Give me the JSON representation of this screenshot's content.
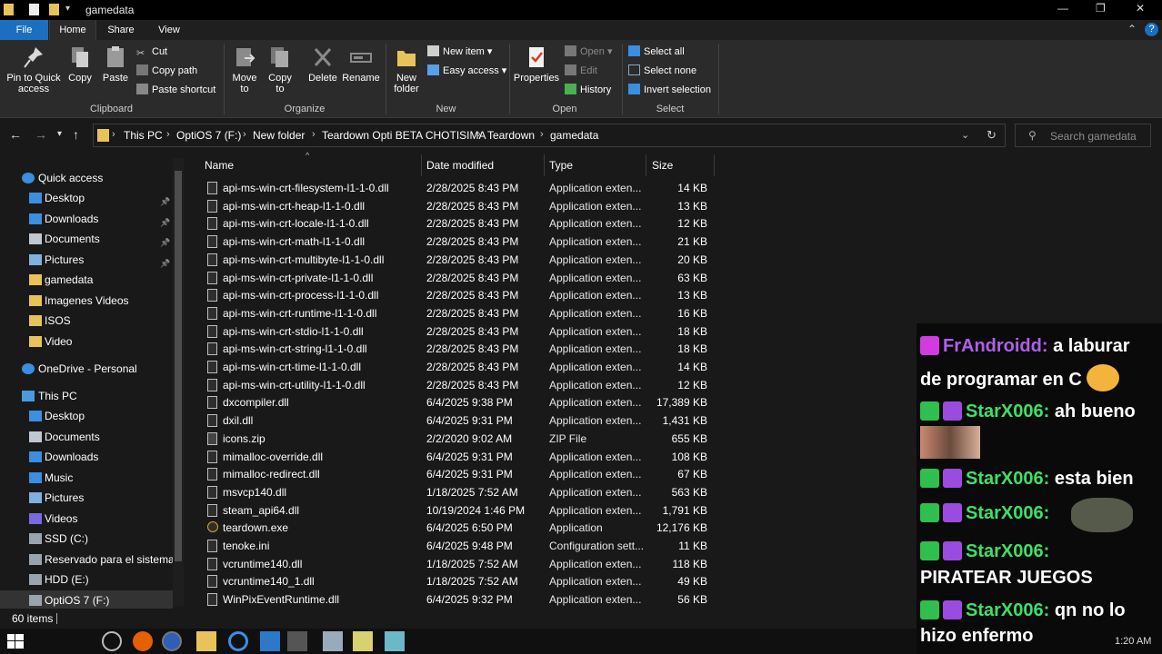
{
  "window": {
    "title": "gamedata",
    "help_glyph": "?",
    "collapse_glyph": "⌃"
  },
  "tabs": [
    "File",
    "Home",
    "Share",
    "View"
  ],
  "ribbon": {
    "clipboard": {
      "pin": "Pin to Quick access",
      "copy": "Copy",
      "paste": "Paste",
      "cut": "Cut",
      "copy_path": "Copy path",
      "paste_shortcut": "Paste shortcut",
      "label": "Clipboard"
    },
    "organize": {
      "move_to": "Move to",
      "copy_to": "Copy to",
      "delete": "Delete",
      "rename": "Rename",
      "label": "Organize"
    },
    "new": {
      "new_folder": "New folder",
      "new_item": "New item",
      "easy_access": "Easy access",
      "label": "New"
    },
    "open": {
      "properties": "Properties",
      "open": "Open",
      "edit": "Edit",
      "history": "History",
      "label": "Open"
    },
    "select": {
      "select_all": "Select all",
      "select_none": "Select none",
      "invert": "Invert selection",
      "label": "Select"
    }
  },
  "breadcrumb": [
    "This PC",
    "OptiOS 7 (F:)",
    "New folder",
    "Teardown Opti BETA CHOTISIMA",
    "Teardown",
    "gamedata"
  ],
  "search": {
    "placeholder": "Search gamedata"
  },
  "nav": [
    {
      "label": "Quick access",
      "icon": "star-icon",
      "pinned": false
    },
    {
      "label": "Desktop",
      "icon": "desktop-icon",
      "pinned": true
    },
    {
      "label": "Downloads",
      "icon": "download-icon",
      "pinned": true
    },
    {
      "label": "Documents",
      "icon": "documents-icon",
      "pinned": true
    },
    {
      "label": "Pictures",
      "icon": "pictures-icon",
      "pinned": true
    },
    {
      "label": "gamedata",
      "icon": "folder-icon",
      "pinned": false
    },
    {
      "label": "Imagenes Videos",
      "icon": "folder-icon",
      "pinned": false
    },
    {
      "label": "ISOS",
      "icon": "folder-icon",
      "pinned": false
    },
    {
      "label": "Video",
      "icon": "folder-icon",
      "pinned": false
    },
    {
      "label": "OneDrive - Personal",
      "icon": "cloud-icon",
      "pinned": false
    },
    {
      "label": "This PC",
      "icon": "pc-icon",
      "pinned": false
    },
    {
      "label": "Desktop",
      "icon": "desktop-icon",
      "pinned": false
    },
    {
      "label": "Documents",
      "icon": "documents-icon",
      "pinned": false
    },
    {
      "label": "Downloads",
      "icon": "download-icon",
      "pinned": false
    },
    {
      "label": "Music",
      "icon": "music-icon",
      "pinned": false
    },
    {
      "label": "Pictures",
      "icon": "pictures-icon",
      "pinned": false
    },
    {
      "label": "Videos",
      "icon": "videos-icon",
      "pinned": false
    },
    {
      "label": "SSD (C:)",
      "icon": "drive-icon",
      "pinned": false
    },
    {
      "label": "Reservado para el sistema (D",
      "icon": "drive-icon",
      "pinned": false
    },
    {
      "label": "HDD (E:)",
      "icon": "drive-icon",
      "pinned": false
    },
    {
      "label": "OptiOS 7 (F:)",
      "icon": "drive-icon",
      "pinned": false
    }
  ],
  "columns": {
    "name": "Name",
    "date": "Date modified",
    "type": "Type",
    "size": "Size"
  },
  "files": [
    {
      "name": "api-ms-win-crt-filesystem-l1-1-0.dll",
      "date": "2/28/2025 8:43 PM",
      "type": "Application exten...",
      "size": "14 KB",
      "icon": "dll-icon"
    },
    {
      "name": "api-ms-win-crt-heap-l1-1-0.dll",
      "date": "2/28/2025 8:43 PM",
      "type": "Application exten...",
      "size": "13 KB",
      "icon": "dll-icon"
    },
    {
      "name": "api-ms-win-crt-locale-l1-1-0.dll",
      "date": "2/28/2025 8:43 PM",
      "type": "Application exten...",
      "size": "12 KB",
      "icon": "dll-icon"
    },
    {
      "name": "api-ms-win-crt-math-l1-1-0.dll",
      "date": "2/28/2025 8:43 PM",
      "type": "Application exten...",
      "size": "21 KB",
      "icon": "dll-icon"
    },
    {
      "name": "api-ms-win-crt-multibyte-l1-1-0.dll",
      "date": "2/28/2025 8:43 PM",
      "type": "Application exten...",
      "size": "20 KB",
      "icon": "dll-icon"
    },
    {
      "name": "api-ms-win-crt-private-l1-1-0.dll",
      "date": "2/28/2025 8:43 PM",
      "type": "Application exten...",
      "size": "63 KB",
      "icon": "dll-icon"
    },
    {
      "name": "api-ms-win-crt-process-l1-1-0.dll",
      "date": "2/28/2025 8:43 PM",
      "type": "Application exten...",
      "size": "13 KB",
      "icon": "dll-icon"
    },
    {
      "name": "api-ms-win-crt-runtime-l1-1-0.dll",
      "date": "2/28/2025 8:43 PM",
      "type": "Application exten...",
      "size": "16 KB",
      "icon": "dll-icon"
    },
    {
      "name": "api-ms-win-crt-stdio-l1-1-0.dll",
      "date": "2/28/2025 8:43 PM",
      "type": "Application exten...",
      "size": "18 KB",
      "icon": "dll-icon"
    },
    {
      "name": "api-ms-win-crt-string-l1-1-0.dll",
      "date": "2/28/2025 8:43 PM",
      "type": "Application exten...",
      "size": "18 KB",
      "icon": "dll-icon"
    },
    {
      "name": "api-ms-win-crt-time-l1-1-0.dll",
      "date": "2/28/2025 8:43 PM",
      "type": "Application exten...",
      "size": "14 KB",
      "icon": "dll-icon"
    },
    {
      "name": "api-ms-win-crt-utility-l1-1-0.dll",
      "date": "2/28/2025 8:43 PM",
      "type": "Application exten...",
      "size": "12 KB",
      "icon": "dll-icon"
    },
    {
      "name": "dxcompiler.dll",
      "date": "6/4/2025 9:38 PM",
      "type": "Application exten...",
      "size": "17,389 KB",
      "icon": "dll-icon"
    },
    {
      "name": "dxil.dll",
      "date": "6/4/2025 9:31 PM",
      "type": "Application exten...",
      "size": "1,431 KB",
      "icon": "dll-icon"
    },
    {
      "name": "icons.zip",
      "date": "2/2/2020 9:02 AM",
      "type": "ZIP File",
      "size": "655 KB",
      "icon": "zip-icon"
    },
    {
      "name": "mimalloc-override.dll",
      "date": "6/4/2025 9:31 PM",
      "type": "Application exten...",
      "size": "108 KB",
      "icon": "dll-icon"
    },
    {
      "name": "mimalloc-redirect.dll",
      "date": "6/4/2025 9:31 PM",
      "type": "Application exten...",
      "size": "67 KB",
      "icon": "dll-icon"
    },
    {
      "name": "msvcp140.dll",
      "date": "1/18/2025 7:52 AM",
      "type": "Application exten...",
      "size": "563 KB",
      "icon": "dll-icon"
    },
    {
      "name": "steam_api64.dll",
      "date": "10/19/2024 1:46 PM",
      "type": "Application exten...",
      "size": "1,791 KB",
      "icon": "dll-icon"
    },
    {
      "name": "teardown.exe",
      "date": "6/4/2025 6:50 PM",
      "type": "Application",
      "size": "12,176 KB",
      "icon": "exe-icon"
    },
    {
      "name": "tenoke.ini",
      "date": "6/4/2025 9:48 PM",
      "type": "Configuration sett...",
      "size": "11 KB",
      "icon": "ini-icon"
    },
    {
      "name": "vcruntime140.dll",
      "date": "1/18/2025 7:52 AM",
      "type": "Application exten...",
      "size": "118 KB",
      "icon": "dll-icon"
    },
    {
      "name": "vcruntime140_1.dll",
      "date": "1/18/2025 7:52 AM",
      "type": "Application exten...",
      "size": "49 KB",
      "icon": "dll-icon"
    },
    {
      "name": "WinPixEventRuntime.dll",
      "date": "6/4/2025 9:32 PM",
      "type": "Application exten...",
      "size": "56 KB",
      "icon": "dll-icon"
    }
  ],
  "status": {
    "items": "60 items"
  },
  "clock": "1:20 AM",
  "chat": [
    {
      "user": "FrAndroidd",
      "text_a": "a laburar",
      "text_b": "de programar en C",
      "user_color": "#b15fe8"
    },
    {
      "user": "StarX006",
      "text_a": "ah bueno",
      "user_color": "#3fe067"
    },
    {
      "user": "StarX006",
      "text_a": "esta bien",
      "user_color": "#3fe067"
    },
    {
      "user": "StarX006",
      "text_a": "",
      "user_color": "#3fe067"
    },
    {
      "user": "StarX006",
      "text_a": "",
      "text_b": "PIRATEAR JUEGOS",
      "user_color": "#3fe067"
    },
    {
      "user": "StarX006",
      "text_a": "qn no lo",
      "text_b": "hizo enfermo",
      "user_color": "#3fe067"
    }
  ],
  "chat_sep": ":"
}
